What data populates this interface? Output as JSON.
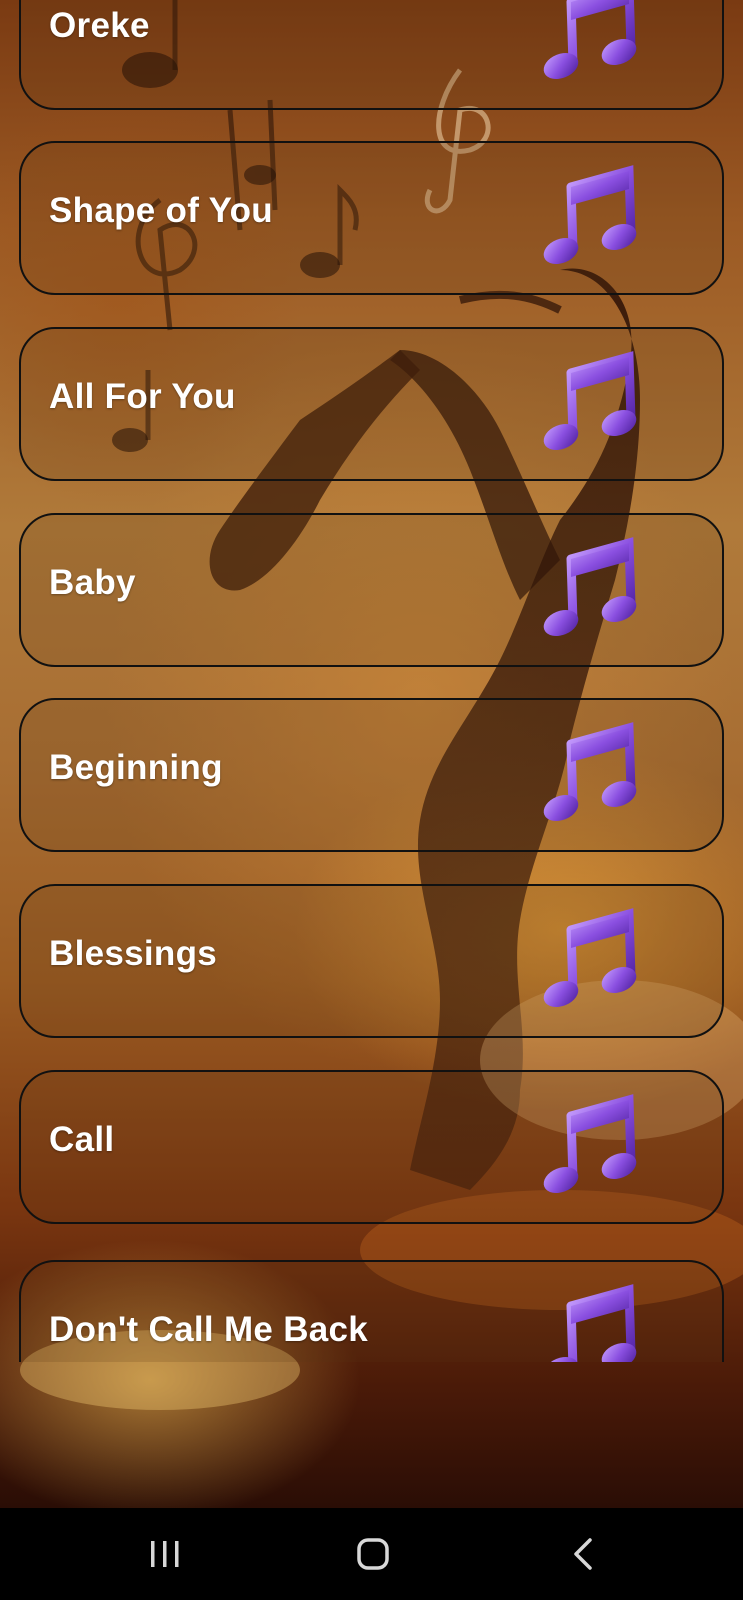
{
  "songs": [
    {
      "title": "Oreke",
      "icon": "music-note-icon"
    },
    {
      "title": "Shape of You",
      "icon": "music-note-icon"
    },
    {
      "title": "All For You",
      "icon": "music-note-icon"
    },
    {
      "title": "Baby",
      "icon": "music-note-icon"
    },
    {
      "title": "Beginning",
      "icon": "music-note-icon"
    },
    {
      "title": "Blessings",
      "icon": "music-note-icon"
    },
    {
      "title": "Call",
      "icon": "music-note-icon"
    },
    {
      "title": "Don't Call Me Back",
      "icon": "music-note-icon"
    }
  ],
  "colors": {
    "card_border": "#111111",
    "title_text": "#ffffff",
    "note_purple": "#8a4fe0",
    "nav_background": "#000000"
  },
  "nav_bar": {
    "buttons": [
      "recent-apps-icon",
      "home-icon",
      "back-icon"
    ]
  }
}
